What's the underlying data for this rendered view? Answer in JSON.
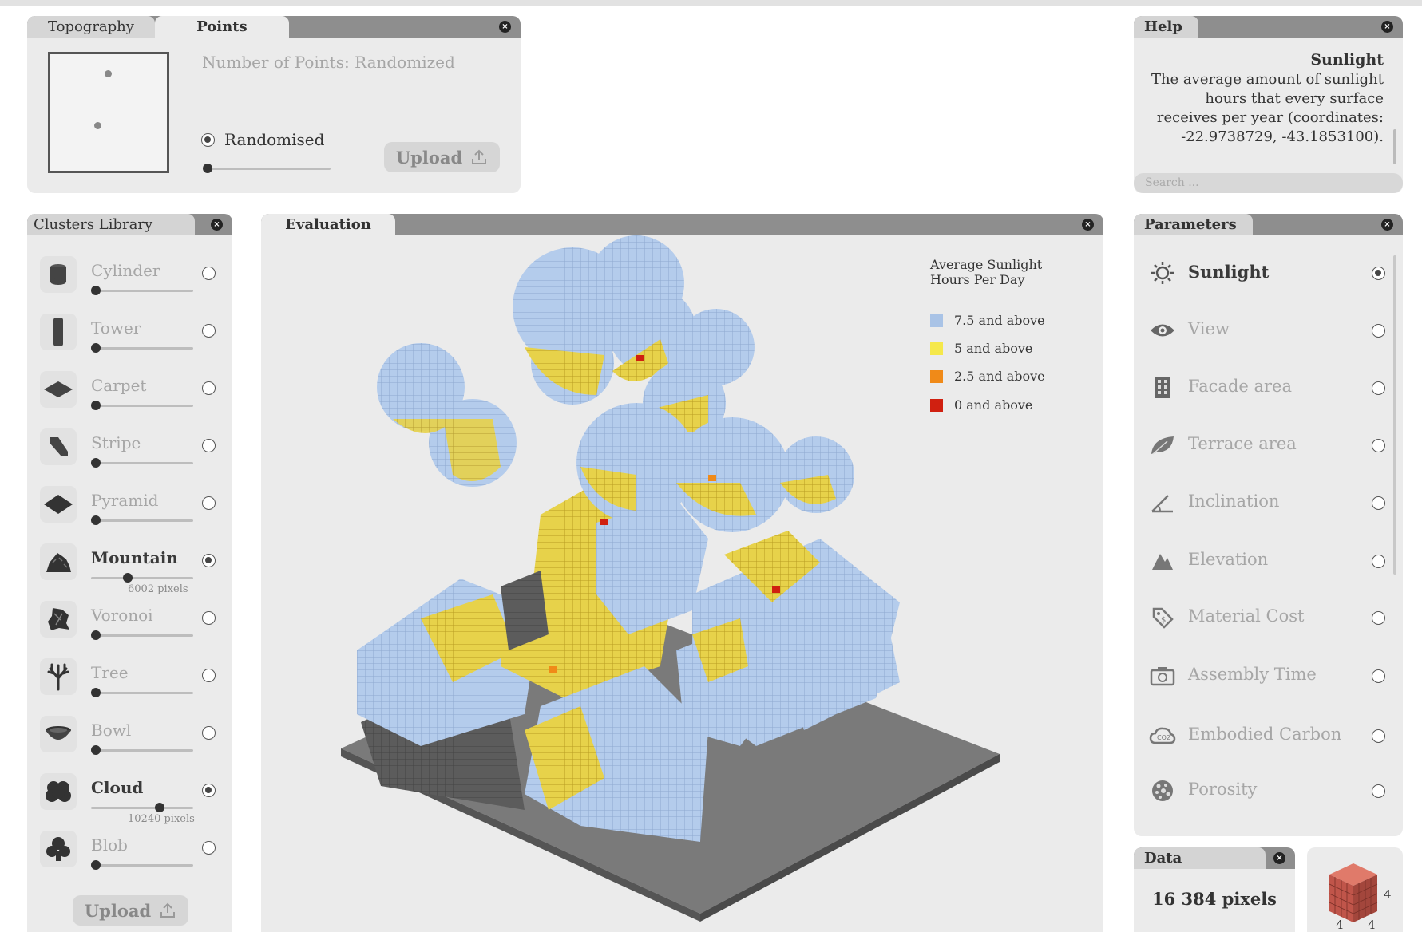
{
  "topography_panel": {
    "tabs": [
      "Topography",
      "Points"
    ],
    "number_of_points_label": "Number of Points: Randomized",
    "mode_label": "Randomised",
    "upload_label": "Upload"
  },
  "help_panel": {
    "title": "Help",
    "heading": "Sunlight",
    "body": "The average amount of sunlight hours that every surface receives per year (coordinates: -22.9738729, -43.1853100).",
    "search_placeholder": "Search ..."
  },
  "clusters_panel": {
    "title": "Clusters Library",
    "items": [
      {
        "label": "Cylinder",
        "selected": false,
        "sub": ""
      },
      {
        "label": "Tower",
        "selected": false,
        "sub": ""
      },
      {
        "label": "Carpet",
        "selected": false,
        "sub": ""
      },
      {
        "label": "Stripe",
        "selected": false,
        "sub": ""
      },
      {
        "label": "Pyramid",
        "selected": false,
        "sub": ""
      },
      {
        "label": "Mountain",
        "selected": true,
        "sub": "6002 pixels"
      },
      {
        "label": "Voronoi",
        "selected": false,
        "sub": ""
      },
      {
        "label": "Tree",
        "selected": false,
        "sub": ""
      },
      {
        "label": "Bowl",
        "selected": false,
        "sub": ""
      },
      {
        "label": "Cloud",
        "selected": true,
        "sub": "10240 pixels"
      },
      {
        "label": "Blob",
        "selected": false,
        "sub": ""
      }
    ],
    "upload_label": "Upload"
  },
  "evaluation_panel": {
    "title": "Evaluation",
    "legend_title_1": "Average Sunlight",
    "legend_title_2": "Hours Per Day",
    "legend": [
      {
        "label": "7.5 and above",
        "color": "#a9c3e6"
      },
      {
        "label": "5 and above",
        "color": "#f5e84a"
      },
      {
        "label": "2.5 and above",
        "color": "#f08a18"
      },
      {
        "label": "0 and above",
        "color": "#d02010"
      }
    ]
  },
  "parameters_panel": {
    "title": "Parameters",
    "items": [
      {
        "label": "Sunlight",
        "selected": true,
        "icon": "sun-icon"
      },
      {
        "label": "View",
        "selected": false,
        "icon": "eye-icon"
      },
      {
        "label": "Facade area",
        "selected": false,
        "icon": "building-icon"
      },
      {
        "label": "Terrace area",
        "selected": false,
        "icon": "leaf-icon"
      },
      {
        "label": "Inclination",
        "selected": false,
        "icon": "angle-icon"
      },
      {
        "label": "Elevation",
        "selected": false,
        "icon": "mountain-icon"
      },
      {
        "label": "Material Cost",
        "selected": false,
        "icon": "price-tag-icon"
      },
      {
        "label": "Assembly Time",
        "selected": false,
        "icon": "camera-icon"
      },
      {
        "label": "Embodied Carbon",
        "selected": false,
        "icon": "co2-cloud-icon"
      },
      {
        "label": "Porosity",
        "selected": false,
        "icon": "porosity-icon"
      }
    ]
  },
  "data_panel": {
    "title": "Data",
    "value": "16 384 pixels",
    "cube_dims": [
      "4",
      "4",
      "4"
    ]
  },
  "colors": {
    "panel_bg": "#ebebeb",
    "header_bg": "#8e8e8e",
    "voxel_light": "#a9c3e6",
    "voxel_yellow": "#f5e84a"
  }
}
